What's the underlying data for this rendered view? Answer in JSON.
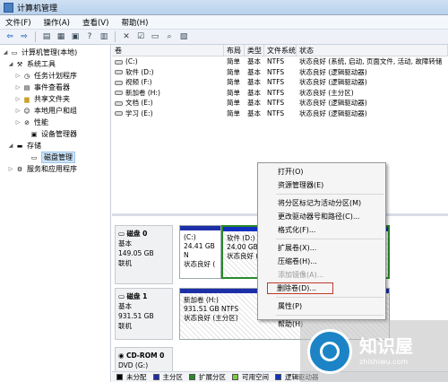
{
  "window": {
    "title": "计算机管理"
  },
  "menu": [
    "文件(F)",
    "操作(A)",
    "查看(V)",
    "帮助(H)"
  ],
  "toolbar_icons": [
    "back-arrow-icon",
    "forward-arrow-icon",
    "up-folder-icon",
    "show-tree-icon",
    "properties-icon",
    "help-icon",
    "console-icon",
    "delete-icon",
    "check-icon",
    "open-folder-icon",
    "search-icon",
    "refresh-icon"
  ],
  "tree": {
    "root": "计算机管理(本地)",
    "system_tools": "系统工具",
    "task_scheduler": "任务计划程序",
    "event_viewer": "事件查看器",
    "shared_folders": "共享文件夹",
    "local_users": "本地用户和组",
    "performance": "性能",
    "device_manager": "设备管理器",
    "storage": "存储",
    "disk_management": "磁盘管理",
    "services_apps": "服务和应用程序"
  },
  "volume_list": {
    "headers": [
      "卷",
      "布局",
      "类型",
      "文件系统",
      "状态"
    ],
    "rows": [
      {
        "name": "(C:)",
        "layout": "简单",
        "type": "基本",
        "fs": "NTFS",
        "status": "状态良好 (系统, 启动, 页面文件, 活动, 故障转储"
      },
      {
        "name": "软件 (D:)",
        "layout": "简单",
        "type": "基本",
        "fs": "NTFS",
        "status": "状态良好 (逻辑驱动器)"
      },
      {
        "name": "视频 (F:)",
        "layout": "简单",
        "type": "基本",
        "fs": "NTFS",
        "status": "状态良好 (逻辑驱动器)"
      },
      {
        "name": "新加卷 (H:)",
        "layout": "简单",
        "type": "基本",
        "fs": "NTFS",
        "status": "状态良好 (主分区)"
      },
      {
        "name": "文档 (E:)",
        "layout": "简单",
        "type": "基本",
        "fs": "NTFS",
        "status": "状态良好 (逻辑驱动器)"
      },
      {
        "name": "学习 (E:)",
        "layout": "简单",
        "type": "基本",
        "fs": "NTFS",
        "status": "状态良好 (逻辑驱动器)"
      }
    ]
  },
  "disks": {
    "disk0": {
      "name": "磁盘 0",
      "type": "基本",
      "size": "149.05 GB",
      "status": "联机",
      "p1": {
        "label": "(C:)",
        "size": "24.41 GB N",
        "status": "状态良好 ("
      },
      "p2": {
        "label": "软件 (D:)",
        "size": "24.00 GB",
        "status": "状态良好 ("
      }
    },
    "disk1": {
      "name": "磁盘 1",
      "type": "基本",
      "size": "931.51 GB",
      "status": "联机",
      "p1": {
        "label": "新加卷 (H:)",
        "size": "931.51 GB NTFS",
        "status": "状态良好 (主分区)"
      }
    },
    "cdrom": {
      "name": "CD-ROM 0",
      "label": "DVD (G:)"
    }
  },
  "legend": [
    {
      "label": "未分配",
      "color": "#000000"
    },
    {
      "label": "主分区",
      "color": "#1d2fa8"
    },
    {
      "label": "扩展分区",
      "color": "#2a8a2a"
    },
    {
      "label": "可用空间",
      "color": "#7ccb3c"
    },
    {
      "label": "逻辑驱动器",
      "color": "#1030c0"
    }
  ],
  "context_menu": {
    "open": "打开(O)",
    "explorer": "资源管理器(E)",
    "mark_active": "将分区标记为活动分区(M)",
    "change_letter": "更改驱动器号和路径(C)...",
    "format": "格式化(F)...",
    "extend": "扩展卷(X)...",
    "shrink": "压缩卷(H)...",
    "mirror": "添加镜像(A)...",
    "delete": "删除卷(D)...",
    "properties": "属性(P)",
    "help": "帮助(H)"
  },
  "watermark": {
    "brand": "知识屋",
    "url": "zhishiwu.com"
  }
}
